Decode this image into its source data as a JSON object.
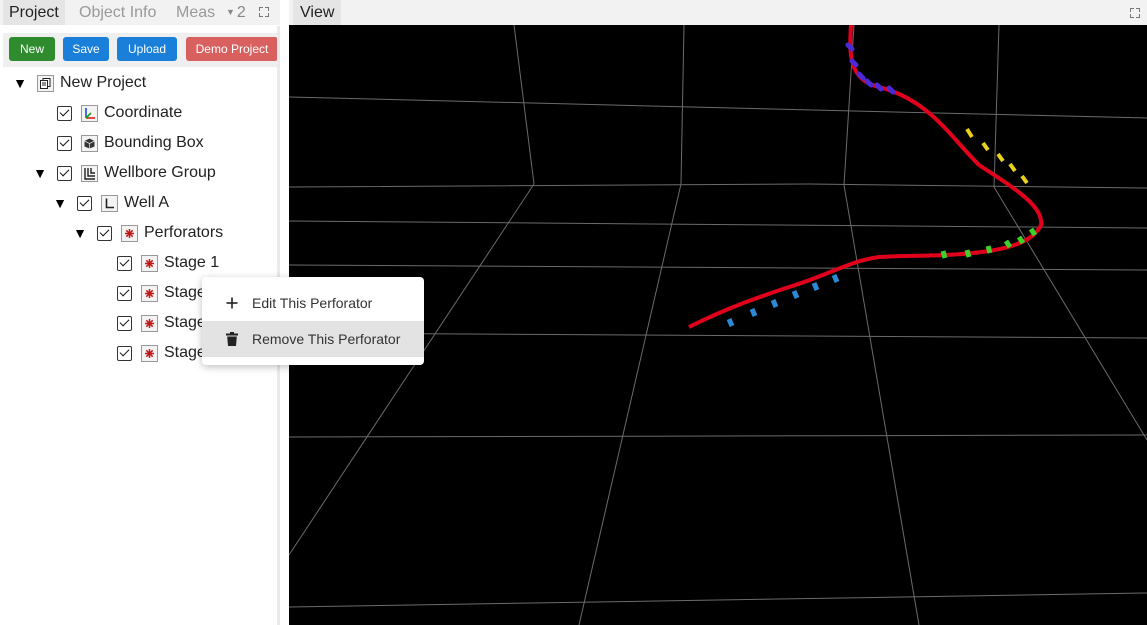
{
  "left_tabs": {
    "project": "Project",
    "object_info": "Object Info",
    "meas": "Meas",
    "more_count": "2"
  },
  "buttons": {
    "new": "New",
    "save": "Save",
    "upload": "Upload",
    "demo": "Demo Project"
  },
  "tree": {
    "project": "New Project",
    "coordinate": "Coordinate",
    "bounding_box": "Bounding Box",
    "wellbore_group": "Wellbore Group",
    "well_a": "Well A",
    "perforators": "Perforators",
    "stages": [
      "Stage 1",
      "Stage",
      "Stage",
      "Stage"
    ]
  },
  "context_menu": {
    "edit": "Edit This Perforator",
    "remove": "Remove This Perforator"
  },
  "view": {
    "tab": "View",
    "background": "#000000",
    "grid_color": "#6b6b6b",
    "well_color": "#e0001b",
    "perforator_colors": [
      "#4b2ad6",
      "#e8d21a",
      "#3fd02a",
      "#2a8ad6"
    ]
  },
  "icons": [
    "chevron-down-icon",
    "maximize-icon",
    "checkbox-icon",
    "project-icon",
    "coordinate-axes-icon",
    "cube-icon",
    "wellbore-group-icon",
    "well-icon",
    "perforator-icon",
    "plus-icon",
    "trash-icon"
  ]
}
